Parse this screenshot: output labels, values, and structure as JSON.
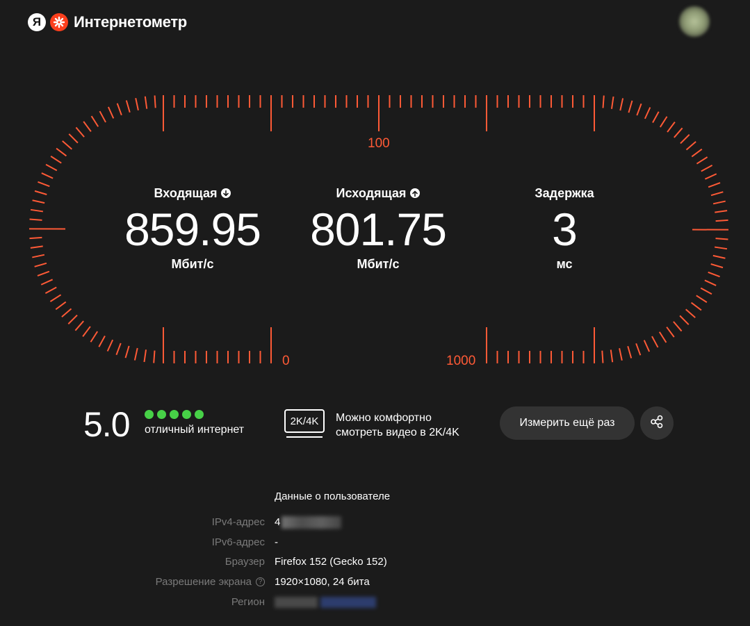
{
  "app": {
    "logo_letter": "Я",
    "title": "Интернетометр"
  },
  "gauge": {
    "accent_color": "#ff5a36",
    "labels": {
      "top": "100",
      "left_bottom": "0",
      "right_bottom": "1000"
    }
  },
  "metrics": {
    "download": {
      "label": "Входящая",
      "value": "859.95",
      "unit": "Мбит/с",
      "icon": "arrow-down-icon"
    },
    "upload": {
      "label": "Исходящая",
      "value": "801.75",
      "unit": "Мбит/с",
      "icon": "arrow-up-icon"
    },
    "latency": {
      "label": "Задержка",
      "value": "3",
      "unit": "мс"
    }
  },
  "rating": {
    "score": "5.0",
    "dots_filled": 5,
    "dots_total": 5,
    "dot_color": "#47d147",
    "text": "отличный интернет"
  },
  "video": {
    "badge": "2K/4K",
    "line1": "Можно комфортно",
    "line2": "смотреть видео в 2K/4K"
  },
  "actions": {
    "measure_again": "Измерить ещё раз",
    "share_icon": "share-icon"
  },
  "user_data": {
    "title": "Данные о пользователе",
    "rows": [
      {
        "label": "IPv4-адрес",
        "value": "4"
      },
      {
        "label": "IPv6-адрес",
        "value": "-"
      },
      {
        "label": "Браузер",
        "value": "Firefox 152 (Gecko 152)"
      },
      {
        "label": "Разрешение экрана",
        "value": "1920×1080, 24 бита"
      },
      {
        "label": "Регион",
        "value": ""
      }
    ]
  }
}
